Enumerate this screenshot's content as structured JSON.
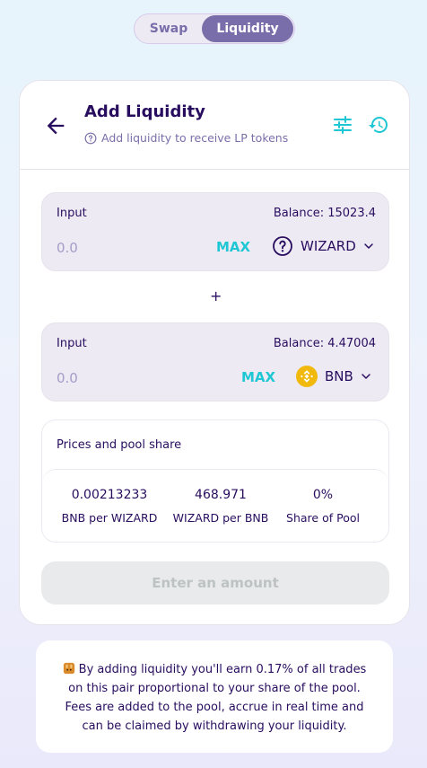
{
  "tabs": {
    "swap": "Swap",
    "liquidity": "Liquidity"
  },
  "header": {
    "title": "Add Liquidity",
    "subtitle": "Add liquidity to receive LP tokens"
  },
  "input_a": {
    "label": "Input",
    "balance": "Balance: 15023.4",
    "value": "0.0",
    "max": "MAX",
    "token": "WIZARD",
    "token_icon": "question-circle-icon"
  },
  "plus": "+",
  "input_b": {
    "label": "Input",
    "balance": "Balance: 4.47004",
    "value": "0.0",
    "max": "MAX",
    "token": "BNB",
    "token_icon": "bnb-icon"
  },
  "prices": {
    "title": "Prices and pool share",
    "items": [
      {
        "value": "0.00213233",
        "label": "BNB per WIZARD"
      },
      {
        "value": "468.971",
        "label": "WIZARD per BNB"
      },
      {
        "value": "0%",
        "label": "Share of Pool"
      }
    ]
  },
  "button": "Enter an amount",
  "notice": "By adding liquidity you'll earn 0.17% of all trades on this pair proportional to your share of the pool. Fees are added to the pool, accrue in real time and can be claimed by withdrawing your liquidity.",
  "colors": {
    "primary": "#1fc7d4",
    "secondary": "#7a6eaa",
    "text": "#280d5f",
    "bnb": "#f0b90b"
  }
}
